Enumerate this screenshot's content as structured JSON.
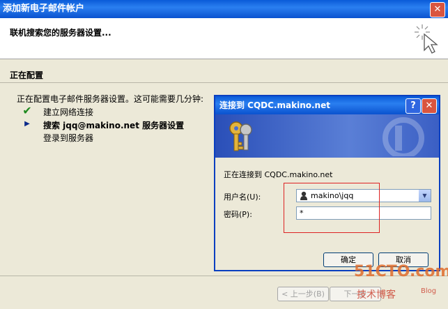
{
  "window": {
    "title": "添加新电子邮件帐户",
    "close_label": "✕"
  },
  "header": {
    "title": "联机搜索您的服务器设置..."
  },
  "section": {
    "title": "正在配置",
    "intro": "正在配置电子邮件服务器设置。这可能需要几分钟:",
    "steps": [
      {
        "label": "建立网络连接",
        "state": "done",
        "mark": "✔"
      },
      {
        "label": "搜索 jqq@makino.net 服务器设置",
        "state": "active",
        "mark": "▶"
      },
      {
        "label": "登录到服务器",
        "state": "pending",
        "mark": ""
      }
    ]
  },
  "wizard_buttons": {
    "back": "< 上一步(B)",
    "next": "下一步"
  },
  "dialog": {
    "title": "连接到 CQDC.makino.net",
    "help_label": "?",
    "close_label": "✕",
    "connecting_text": "正在连接到 CQDC.makino.net",
    "username_label": "用户名(U):",
    "username_value": "makino\\jqq",
    "password_label": "密码(P):",
    "password_value": "*",
    "ok_label": "确定",
    "cancel_label": "取消"
  },
  "watermark": {
    "site": "51CTO.com",
    "tagline": "技术博客",
    "blog": "Blog"
  },
  "colors": {
    "titlebar": "#0a5bd8",
    "dialog_border": "#0a3fc0",
    "highlight_box": "#dd2222"
  }
}
